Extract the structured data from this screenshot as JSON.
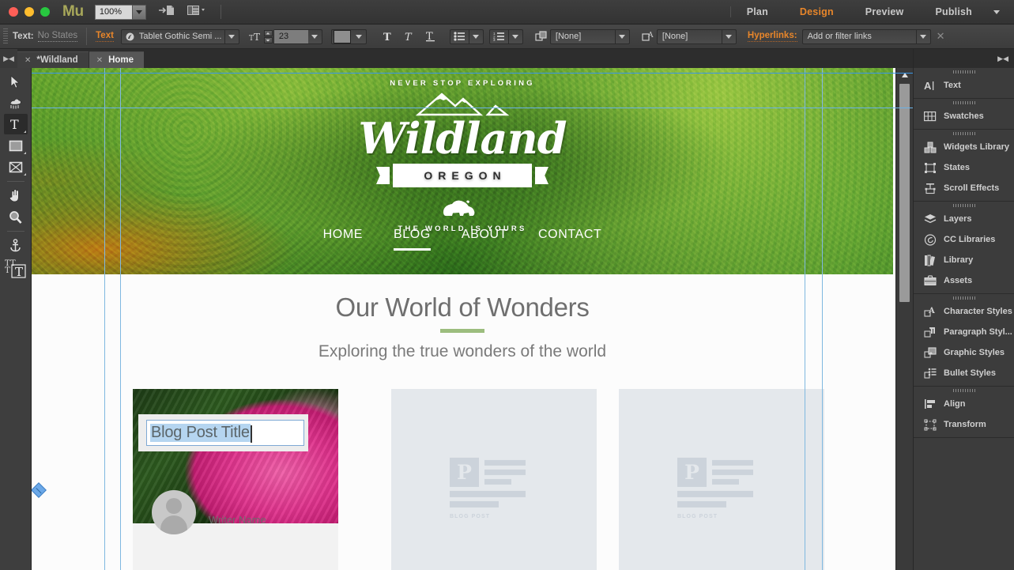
{
  "app": {
    "name": "Mu",
    "zoom": "100%",
    "window_controls": [
      "close",
      "minimize",
      "maximize"
    ]
  },
  "titlebar": {
    "menu": [
      {
        "label": "Plan",
        "active": false
      },
      {
        "label": "Design",
        "active": true
      },
      {
        "label": "Preview",
        "active": false
      },
      {
        "label": "Publish",
        "active": false
      }
    ],
    "icons": [
      "export-page-icon",
      "preview-device-icon"
    ],
    "accent_color": "#e8862a"
  },
  "controlbar": {
    "states_label": "Text:",
    "states_value": "No States",
    "text_link": "Text",
    "font_family": "Tablet Gothic Semi ...",
    "font_size": "23",
    "color_swatch": "#8e8e8e",
    "style_buttons": [
      "bold-T",
      "italic-T",
      "underline-T"
    ],
    "list_buttons": [
      "bulleted-list",
      "numbered-list"
    ],
    "paragraph_style": "[None]",
    "character_style": "[None]",
    "hyperlinks_label": "Hyperlinks:",
    "hyperlinks_value": "Add or filter links"
  },
  "document_tabs": [
    {
      "label": "*Wildland",
      "active": false
    },
    {
      "label": "Home",
      "active": true
    }
  ],
  "tools": [
    {
      "name": "selection-tool",
      "selected": false
    },
    {
      "name": "crop-tool",
      "selected": false
    },
    {
      "name": "text-tool",
      "selected": true
    },
    {
      "name": "rectangle-tool",
      "selected": false
    },
    {
      "name": "image-frame-tool",
      "selected": false
    },
    {
      "name": "hand-tool",
      "selected": false
    },
    {
      "name": "zoom-tool",
      "selected": false
    },
    {
      "name": "anchor-tool",
      "selected": false
    },
    {
      "name": "text-frame-tool",
      "selected": false
    }
  ],
  "panels": [
    {
      "items": [
        {
          "label": "Text",
          "icon": "text-cursor-icon"
        }
      ]
    },
    {
      "items": [
        {
          "label": "Swatches",
          "icon": "swatches-grid-icon"
        }
      ]
    },
    {
      "items": [
        {
          "label": "Widgets Library",
          "icon": "widgets-blocks-icon"
        },
        {
          "label": "States",
          "icon": "states-box-icon"
        },
        {
          "label": "Scroll Effects",
          "icon": "scroll-effects-icon"
        }
      ]
    },
    {
      "items": [
        {
          "label": "Layers",
          "icon": "layers-stack-icon"
        },
        {
          "label": "CC Libraries",
          "icon": "creative-cloud-icon"
        },
        {
          "label": "Library",
          "icon": "library-books-icon"
        },
        {
          "label": "Assets",
          "icon": "assets-briefcase-icon"
        }
      ]
    },
    {
      "items": [
        {
          "label": "Character Styles",
          "icon": "character-styles-icon"
        },
        {
          "label": "Paragraph Styl...",
          "icon": "paragraph-styles-icon"
        },
        {
          "label": "Graphic Styles",
          "icon": "graphic-styles-icon"
        },
        {
          "label": "Bullet Styles",
          "icon": "bullet-styles-icon"
        }
      ]
    },
    {
      "items": [
        {
          "label": "Align",
          "icon": "align-icon"
        },
        {
          "label": "Transform",
          "icon": "transform-icon"
        }
      ]
    }
  ],
  "page": {
    "hero": {
      "arc_top": "NEVER STOP EXPLORING",
      "wordmark": "Wildland",
      "ribbon": "OREGON",
      "arc_bottom": "THE WORLD IS YOURS",
      "nav": [
        {
          "label": "HOME",
          "active": false
        },
        {
          "label": "BLOG",
          "active": true
        },
        {
          "label": "ABOUT",
          "active": false
        },
        {
          "label": "CONTACT",
          "active": false
        }
      ]
    },
    "section": {
      "title": "Our World of Wonders",
      "rule_color": "#9cbd7e",
      "subtitle": "Exploring the true wonders of the world"
    },
    "cards": [
      {
        "type": "post",
        "title_text": "Blog Post Title",
        "writer": "Writer Name",
        "editing": true
      },
      {
        "type": "placeholder",
        "glyph": "P",
        "caption": "BLOG POST"
      },
      {
        "type": "placeholder",
        "glyph": "P",
        "caption": "BLOG POST"
      }
    ]
  }
}
